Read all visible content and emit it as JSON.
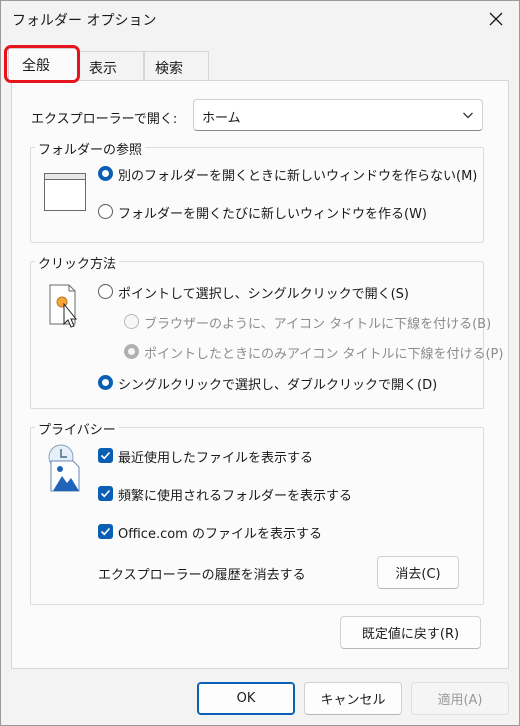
{
  "window": {
    "title": "フォルダー オプション"
  },
  "tabs": [
    {
      "label": "全般",
      "active": true
    },
    {
      "label": "表示",
      "active": false
    },
    {
      "label": "検索",
      "active": false
    }
  ],
  "explorer_open": {
    "label": "エクスプローラーで開く:",
    "value": "ホーム"
  },
  "browse_folders": {
    "title": "フォルダーの参照",
    "options": [
      {
        "label": "別のフォルダーを開くときに新しいウィンドウを作らない(M)",
        "checked": true
      },
      {
        "label": "フォルダーを開くたびに新しいウィンドウを作る(W)",
        "checked": false
      }
    ]
  },
  "click_method": {
    "title": "クリック方法",
    "options": [
      {
        "label": "ポイントして選択し、シングルクリックで開く(S)",
        "checked": false
      },
      {
        "label": "ブラウザーのように、アイコン タイトルに下線を付ける(B)",
        "checked": false,
        "disabled": true
      },
      {
        "label": "ポイントしたときにのみアイコン タイトルに下線を付ける(P)",
        "checked": true,
        "disabled": true
      },
      {
        "label": "シングルクリックで選択し、ダブルクリックで開く(D)",
        "checked": true
      }
    ]
  },
  "privacy": {
    "title": "プライバシー",
    "options": [
      {
        "label": "最近使用したファイルを表示する",
        "checked": true
      },
      {
        "label": "頻繁に使用されるフォルダーを表示する",
        "checked": true
      },
      {
        "label": "Office.com のファイルを表示する",
        "checked": true
      }
    ],
    "clear_label": "エクスプローラーの履歴を消去する",
    "clear_button": "消去(C)"
  },
  "restore_button": "既定値に戻す(R)",
  "footer": {
    "ok": "OK",
    "cancel": "キャンセル",
    "apply": "適用(A)"
  },
  "colors": {
    "accent": "#0a5fb4",
    "highlight_box": "#e8141b"
  }
}
